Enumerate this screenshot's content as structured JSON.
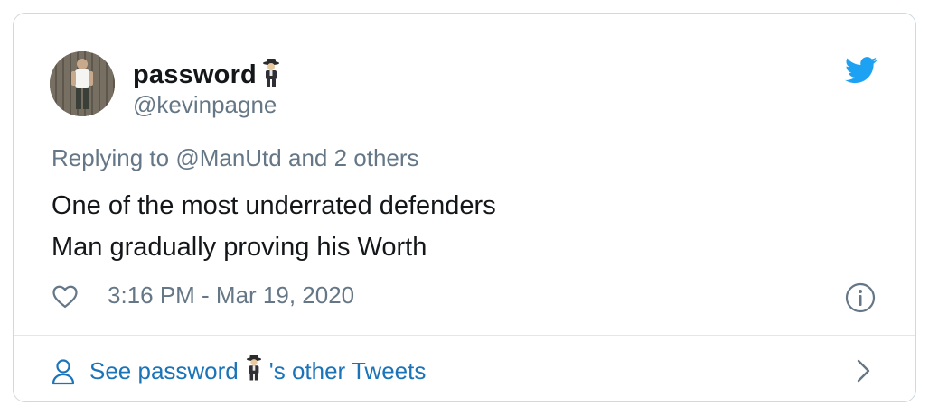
{
  "tweet": {
    "display_name": "password",
    "handle": "@kevinpagne",
    "replying_prefix": "Replying to",
    "replying_mention": "@ManUtd",
    "replying_suffix": "and 2 others",
    "text_line1": "One of the most underrated defenders",
    "text_line2": "Man gradually proving his Worth",
    "timestamp": "3:16 PM - Mar 19, 2020"
  },
  "footer": {
    "prefix": "See password",
    "suffix": "'s other Tweets"
  },
  "colors": {
    "brand": "#1da1f2",
    "link": "#1b74b8",
    "muted": "#657786",
    "text": "#14171a",
    "border": "#cfd9de"
  },
  "icons": [
    "avatar-photo",
    "detective-emoji",
    "twitter-bird-icon",
    "heart-icon",
    "info-icon",
    "user-icon",
    "chevron-right-icon"
  ]
}
